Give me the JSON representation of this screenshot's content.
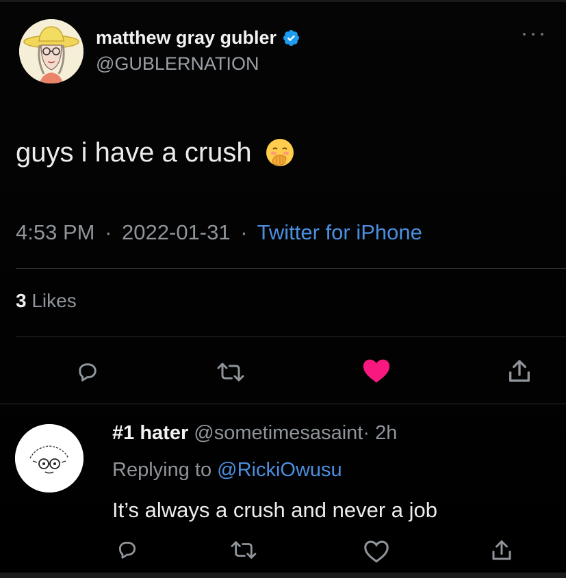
{
  "tweet": {
    "author_name": "matthew gray gubler",
    "author_handle": "@GUBLERNATION",
    "text": "guys i have a crush",
    "emoji": "face-with-hand-over-mouth",
    "time": "4:53 PM",
    "separator": "·",
    "date": "2022-01-31",
    "source": "Twitter for iPhone",
    "likes_count": "3",
    "likes_label": "Likes",
    "liked": true
  },
  "reply": {
    "author_name": "#1 hater",
    "author_handle": "@sometimesasaint",
    "age": "2h",
    "separator": "·",
    "replying_prefix": "Replying to",
    "replying_to": "@RickiOwusu",
    "text": "It’s always a crush and never a job"
  },
  "colors": {
    "background": "#000000",
    "verified_blue": "#1d9bf0",
    "link_blue": "#4b8fe0",
    "like_pink": "#f91880",
    "muted_text": "#8f959a"
  },
  "icons": [
    "verified-badge-icon",
    "more-options-icon",
    "reply-icon",
    "retweet-icon",
    "like-icon",
    "share-icon"
  ]
}
